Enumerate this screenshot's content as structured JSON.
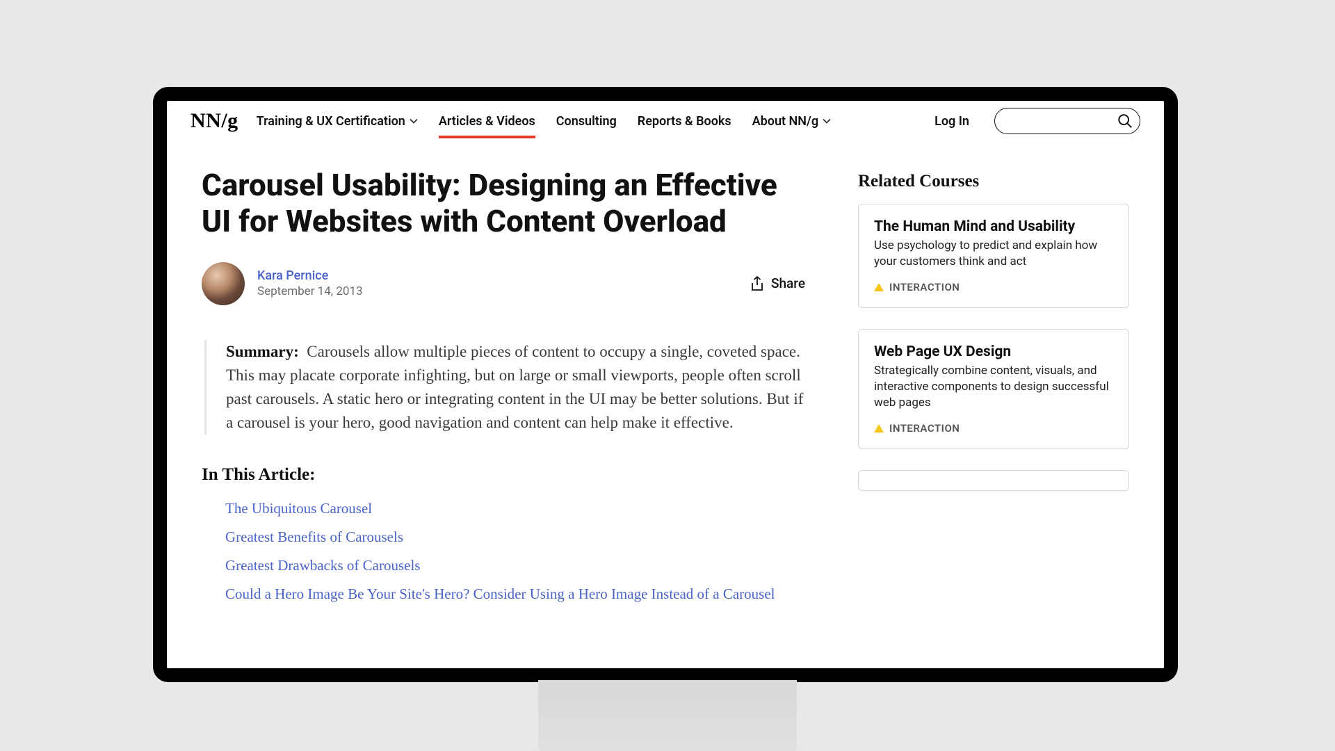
{
  "header": {
    "logo": "NN/g",
    "nav": [
      {
        "label": "Training & UX Certification",
        "dropdown": true,
        "active": false
      },
      {
        "label": "Articles & Videos",
        "dropdown": false,
        "active": true
      },
      {
        "label": "Consulting",
        "dropdown": false,
        "active": false
      },
      {
        "label": "Reports & Books",
        "dropdown": false,
        "active": false
      },
      {
        "label": "About NN/g",
        "dropdown": true,
        "active": false
      }
    ],
    "login": "Log In",
    "search_placeholder": ""
  },
  "article": {
    "title": "Carousel Usability: Designing an Effective UI for Websites with Content Overload",
    "author": "Kara Pernice",
    "date": "September 14, 2013",
    "share_label": "Share",
    "summary_label": "Summary:",
    "summary_text": "Carousels allow multiple pieces of content to occupy a single, coveted space. This may placate corporate infighting, but on large or small viewports, people often scroll past carousels. A static hero or integrating content in the UI may be better solutions. But if a carousel is your hero, good navigation and content can help make it effective.",
    "toc_heading": "In This Article:",
    "toc": [
      "The Ubiquitous Carousel",
      "Greatest Benefits of Carousels",
      "Greatest Drawbacks of Carousels",
      "Could a Hero Image Be Your Site's Hero? Consider Using a Hero Image Instead of a Carousel"
    ]
  },
  "sidebar": {
    "heading": "Related Courses",
    "courses": [
      {
        "title": "The Human Mind and Usability",
        "desc": "Use psychology to predict and explain how your customers think and act",
        "tag": "INTERACTION"
      },
      {
        "title": "Web Page UX Design",
        "desc": "Strategically combine content, visuals, and interactive components to design successful web pages",
        "tag": "INTERACTION"
      }
    ]
  }
}
